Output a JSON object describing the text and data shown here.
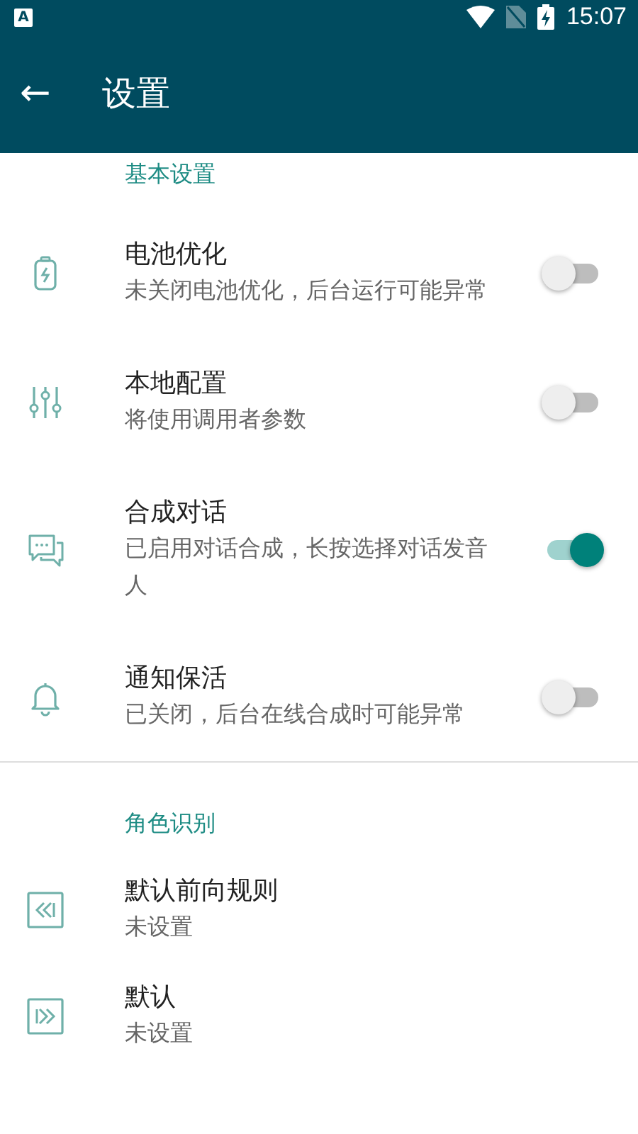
{
  "status_bar": {
    "time": "15:07",
    "app_badge": "A"
  },
  "app_bar": {
    "back": "←",
    "title": "设置"
  },
  "sections": [
    {
      "title": "基本设置",
      "items": [
        {
          "kind": "switch",
          "title": "电池优化",
          "subtitle": "未关闭电池优化，后台运行可能异常",
          "on": false
        },
        {
          "kind": "switch",
          "title": "本地配置",
          "subtitle": "将使用调用者参数",
          "on": false
        },
        {
          "kind": "switch",
          "title": "合成对话",
          "subtitle": "已启用对话合成，长按选择对话发音人",
          "on": true
        },
        {
          "kind": "switch",
          "title": "通知保活",
          "subtitle": "已关闭，后台在线合成时可能异常",
          "on": false
        }
      ]
    },
    {
      "title": "角色识别",
      "items": [
        {
          "kind": "plain",
          "title": "默认前向规则",
          "subtitle": "未设置"
        },
        {
          "kind": "plain",
          "title": "默认",
          "subtitle": "未设置"
        }
      ]
    }
  ]
}
